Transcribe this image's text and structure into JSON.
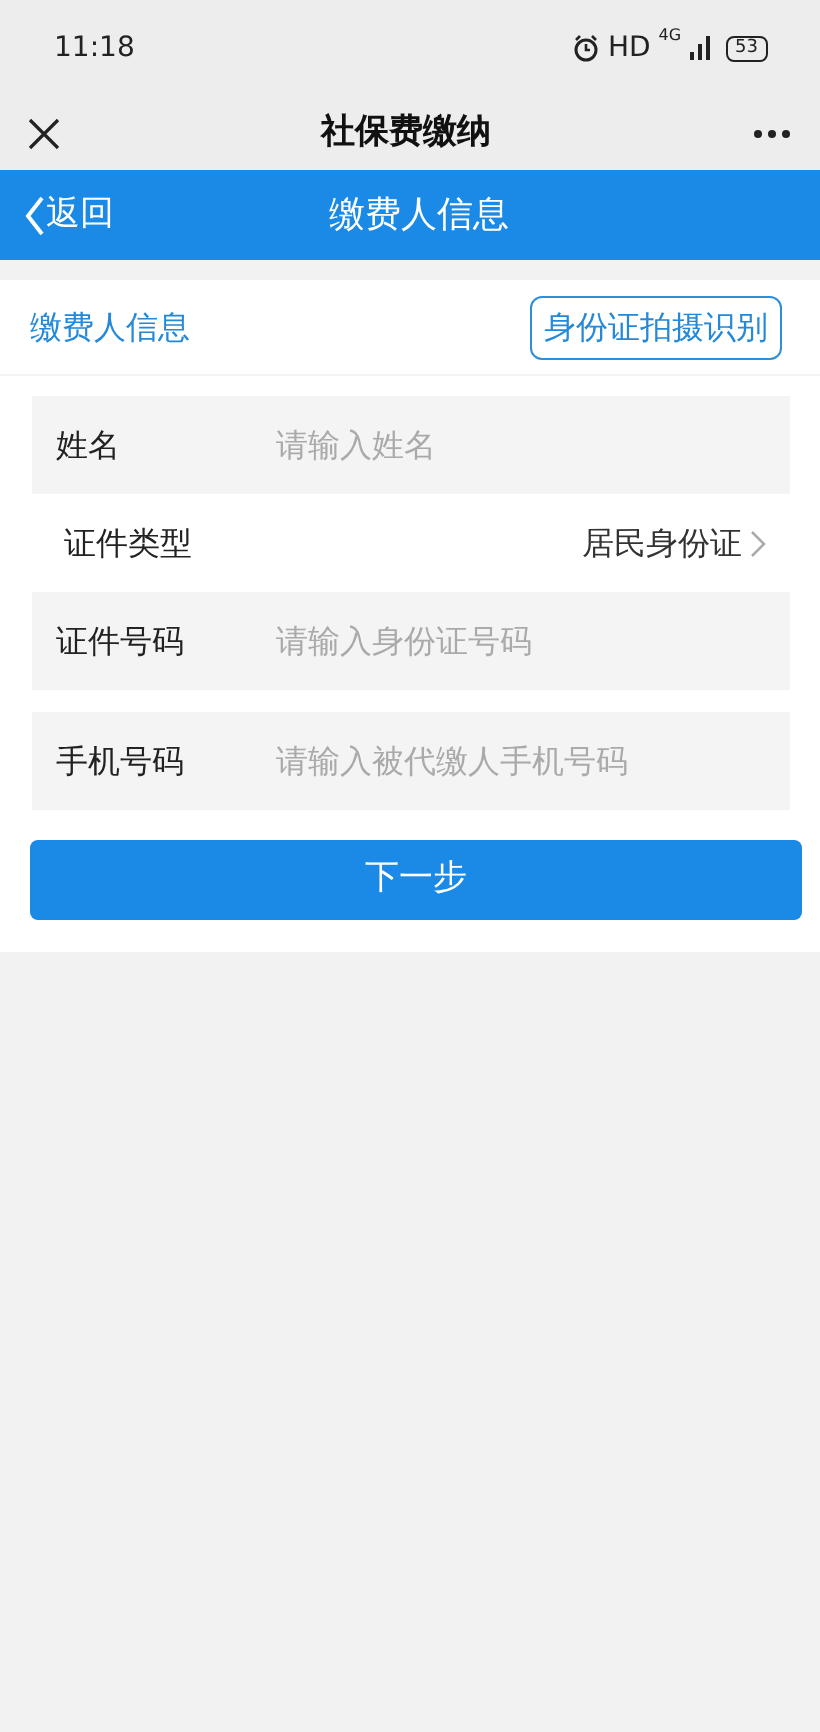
{
  "status_bar": {
    "time": "11:18",
    "hd": "HD",
    "network": "4G",
    "battery": "53"
  },
  "title_bar": {
    "title": "社保费缴纳"
  },
  "header": {
    "back": "返回",
    "title": "缴费人信息"
  },
  "section": {
    "title": "缴费人信息",
    "scan_button": "身份证拍摄识别"
  },
  "fields": [
    {
      "kind": "input",
      "label": "姓名",
      "placeholder": "请输入姓名"
    },
    {
      "kind": "select",
      "label": "证件类型",
      "value": "居民身份证"
    },
    {
      "kind": "input",
      "label": "证件号码",
      "placeholder": "请输入身份证号码"
    },
    {
      "kind": "input",
      "label": "手机号码",
      "placeholder": "请输入被代缴人手机号码"
    }
  ],
  "next_button": "下一步"
}
